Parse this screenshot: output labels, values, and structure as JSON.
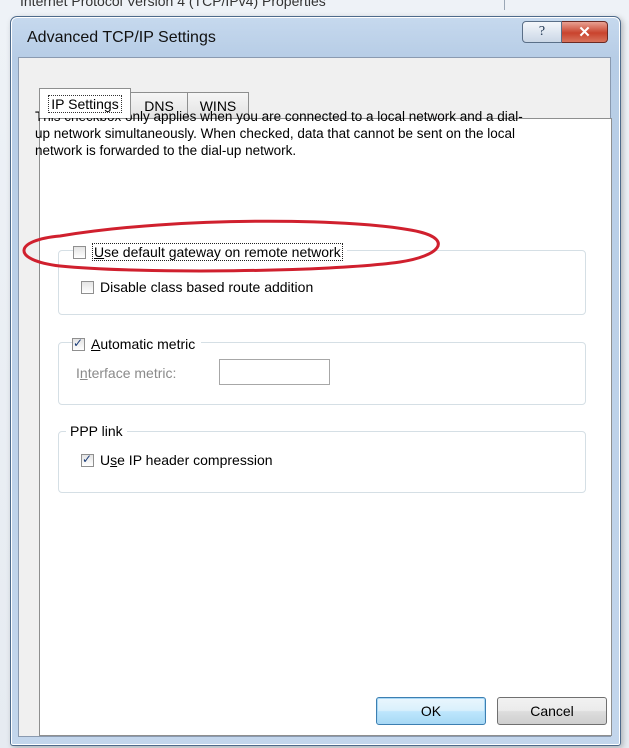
{
  "background_window": {
    "title": "Internet Protocol Version 4 (TCP/IPv4) Properties"
  },
  "dialog": {
    "title": "Advanced TCP/IP Settings",
    "help_label": "?",
    "close_label": "✕"
  },
  "tabs": [
    {
      "label": "IP Settings",
      "active": true
    },
    {
      "label": "DNS",
      "active": false
    },
    {
      "label": "WINS",
      "active": false
    }
  ],
  "description": "This checkbox only applies when you are connected to a local network and a dial-up network simultaneously. When checked, data that cannot be sent on the local network is forwarded to the dial-up network.",
  "gateway_group": {
    "use_default_gateway": {
      "label_prefix": "",
      "label_accel": "U",
      "label_rest": "se default gateway on remote network",
      "checked": false
    },
    "disable_class_route": {
      "label": "Disable class based route addition",
      "checked": false
    }
  },
  "metric_group": {
    "automatic_metric": {
      "label_accel": "A",
      "label_rest": "utomatic metric",
      "checked": true
    },
    "interface_metric": {
      "label_accel": "n",
      "label_pre": "I",
      "label_rest": "terface metric:",
      "value": ""
    }
  },
  "ppp_group": {
    "title": "PPP link",
    "use_ip_header_compression": {
      "label_pre": "U",
      "label_accel": "s",
      "label_rest": "e IP header compression",
      "checked": true
    }
  },
  "buttons": {
    "ok": "OK",
    "cancel": "Cancel"
  },
  "annotation": {
    "color": "#d0202e"
  },
  "colors": {
    "dialog_frame": "#b7cde6",
    "close_button": "#c9432d",
    "default_button_border": "#3c7fb1"
  }
}
